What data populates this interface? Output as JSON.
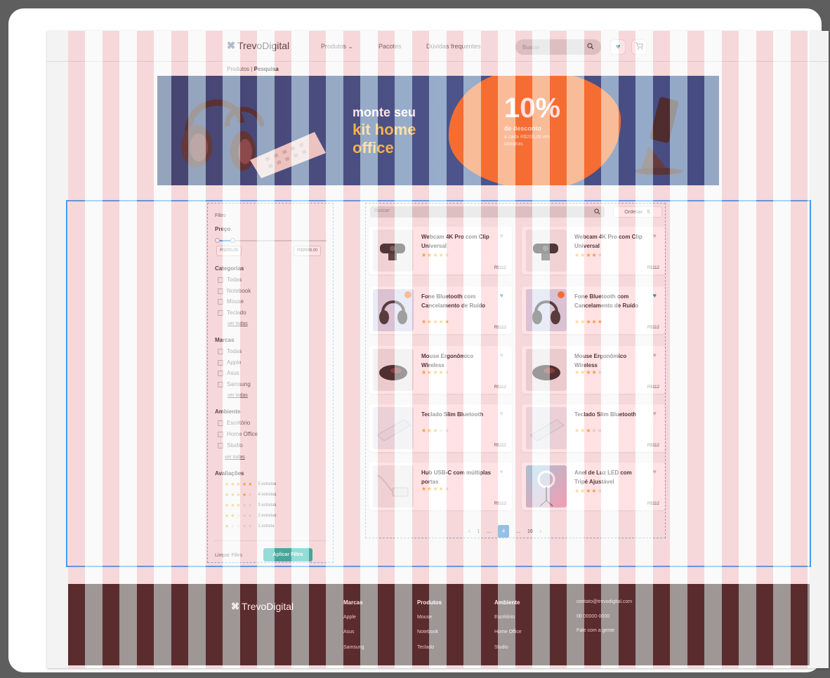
{
  "brand": {
    "name": "TrevoDigital"
  },
  "nav": {
    "products": "Produtos",
    "packages": "Pacotes",
    "faq": "Dúvidas frequentes",
    "search_placeholder": "Buscar"
  },
  "breadcrumb": {
    "root": "Produtos |",
    "current": "Pesquisa"
  },
  "banner": {
    "line1": "monte seu",
    "line2": "kit home office",
    "discount": "10%",
    "discount_label": "de desconto",
    "discount_detail": "a cada R$200,00 em compras",
    "colors": {
      "background": "#1a4a8e",
      "blob": "#f26a1b",
      "highlight": "#f6c03a"
    }
  },
  "filters": {
    "title": "Filtro",
    "price_title": "Preço",
    "price_min": "R$200,00",
    "price_max": "R$9999,00",
    "price_range_fraction": 0.15,
    "categories_title": "Categorias",
    "categories": [
      "Todas",
      "Notebook",
      "Mouse",
      "Teclado"
    ],
    "see_all": "ver todas",
    "brands_title": "Marcas",
    "brands": [
      "Todas",
      "Apple",
      "Asus",
      "Samsung"
    ],
    "environment_title": "Ambiente",
    "environments": [
      "Escritório",
      "Home Office",
      "Studio"
    ],
    "ratings_title": "Avaliações",
    "ratings": [
      {
        "stars": 5,
        "label": "5 estrelas"
      },
      {
        "stars": 4,
        "label": "4 estrelas"
      },
      {
        "stars": 3,
        "label": "3 estrelas"
      },
      {
        "stars": 2,
        "label": "2 estrelas"
      },
      {
        "stars": 1,
        "label": "1 estrela"
      }
    ],
    "clear_label": "Limpar Filtro",
    "apply_label": "Aplicar Filtro",
    "apply_color": "#12b3a4"
  },
  "products": {
    "search_placeholder": "Buscar",
    "sort_label": "Ordenar",
    "items": [
      {
        "name": "Webcam 4K Pro com Clip Universal",
        "rating": 4,
        "price": "R$112",
        "favorite": false
      },
      {
        "name": "Webcam 4K Pro com Clip Universal",
        "rating": 4,
        "price": "R$112",
        "favorite": false
      },
      {
        "name": "Fone Bluetooth com Cancelamento de Ruído",
        "rating": 5,
        "price": "R$112",
        "favorite": true
      },
      {
        "name": "Fone Bluetooth com Cancelamento de Ruído",
        "rating": 5,
        "price": "R$112",
        "favorite": true
      },
      {
        "name": "Mouse Ergonômico Wireless",
        "rating": 4,
        "price": "R$112",
        "favorite": false
      },
      {
        "name": "Mouse Ergonômico Wireless",
        "rating": 4,
        "price": "R$112",
        "favorite": false
      },
      {
        "name": "Teclado Slim Bluetooth",
        "rating": 3,
        "price": "R$112",
        "favorite": false
      },
      {
        "name": "Teclado Slim Bluetooth",
        "rating": 3,
        "price": "R$112",
        "favorite": false
      },
      {
        "name": "Hub USB-C com múltiplas portas",
        "rating": 4,
        "price": "R$112",
        "favorite": false
      },
      {
        "name": "Anel de Luz LED com Tripé Ajustável",
        "rating": 4,
        "price": "R$112",
        "favorite": false
      }
    ],
    "pagination": {
      "prev": "‹",
      "first": "1",
      "ellipsis": "...",
      "current": "4",
      "last": "16",
      "next": "›"
    }
  },
  "footer": {
    "brand": "TrevoDigital",
    "brands_title": "Marcas",
    "brands": [
      "Apple",
      "Asus",
      "Samsung"
    ],
    "products_title": "Produtos",
    "products": [
      "Mouse",
      "Notebook",
      "Teclado"
    ],
    "environment_title": "Ambiente",
    "environments": [
      "Escritório",
      "Home Office",
      "Studio"
    ],
    "email": "contato@trevodigital.com",
    "phone": "00 00000-0000",
    "contact_link": "Fale com a gente",
    "background": "#2b1616"
  },
  "colors": {
    "accent": "#1476c5",
    "teal": "#12b3a4",
    "star": "#f5a623"
  }
}
